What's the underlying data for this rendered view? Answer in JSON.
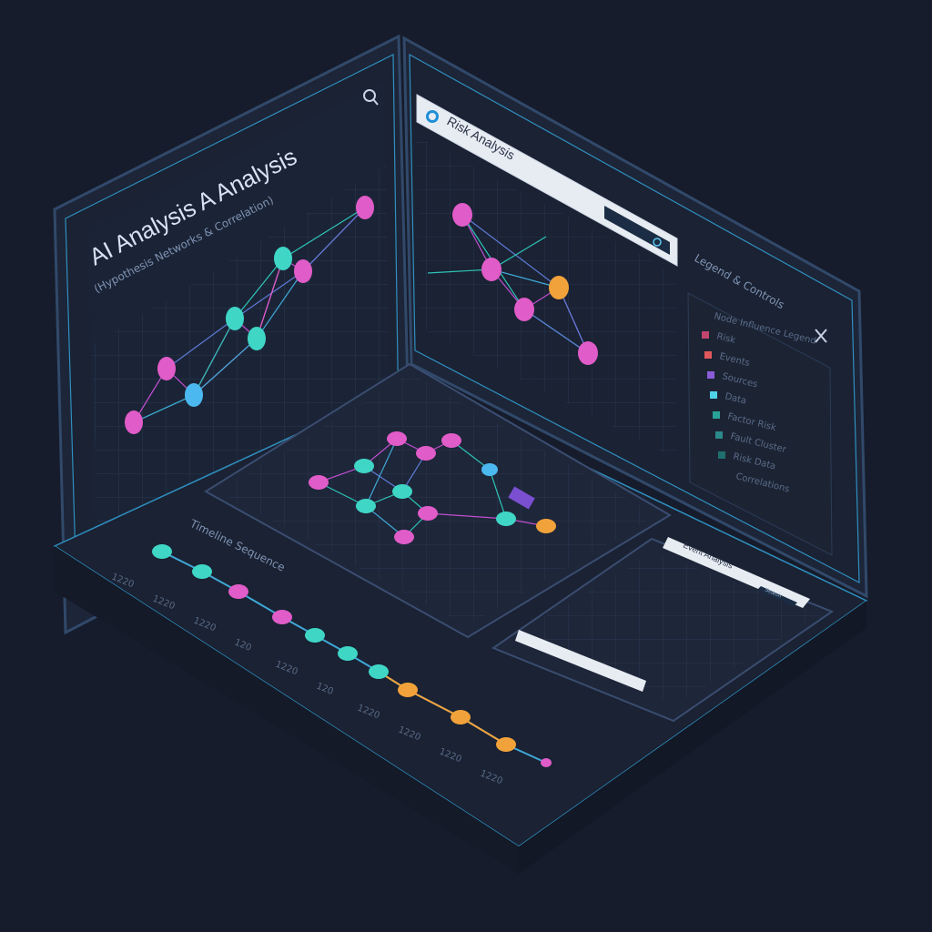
{
  "left_panel": {
    "title": "AI Analysis A Analysis",
    "subtitle": "(Hypothesis Networks & Correlation)",
    "search_icon": "search-icon"
  },
  "right_panel": {
    "search_value": "Risk Analysis",
    "search_button_icon": "search-icon",
    "logo_icon": "globe-logo-icon",
    "legend_title": "Legend & Controls",
    "close_icon": "close-icon",
    "legend_items": [
      {
        "label": "Node Influence Legend",
        "color": ""
      },
      {
        "label": "Risk",
        "color": "#c2456e"
      },
      {
        "label": "Events",
        "color": "#e0585c"
      },
      {
        "label": "Sources",
        "color": "#8a5cd8"
      },
      {
        "label": "Data",
        "color": "#4fd3e8"
      },
      {
        "label": "Factor Risk",
        "color": "#2aa198"
      },
      {
        "label": "Fault Cluster",
        "color": "#2b8a8a"
      },
      {
        "label": "Risk Data",
        "color": "#1f6f6f"
      },
      {
        "label": "Correlations",
        "color": ""
      }
    ]
  },
  "timeline": {
    "title": "Timeline Sequence",
    "time_labels": [
      "1220",
      "1220",
      "1220",
      "120",
      "1220",
      "120",
      "1220",
      "1220",
      "1220",
      "1220"
    ]
  },
  "mini_panel": {
    "search_value": "Event Analysis",
    "search_button_label": "Search"
  },
  "node_colors": {
    "magenta": "#e05cc8",
    "cyan": "#3fd6c6",
    "blue": "#4bb8f0",
    "orange": "#f2a23a",
    "pink": "#d8409a"
  }
}
